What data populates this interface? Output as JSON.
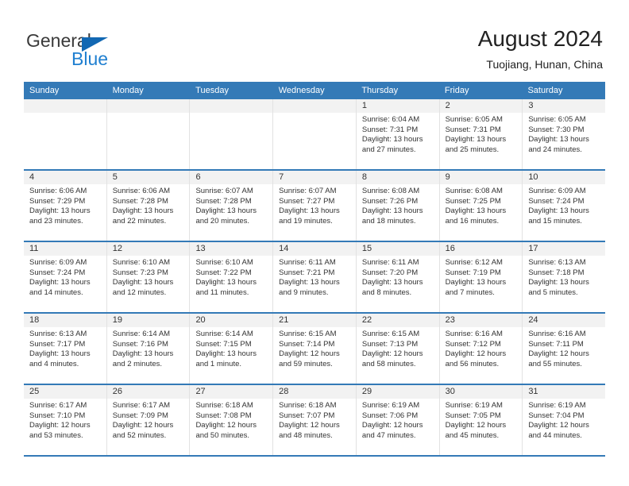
{
  "brand": {
    "name_top": "General",
    "name_bottom": "Blue",
    "triangle_color": "#1268b3",
    "blue_color": "#1f7fd0"
  },
  "header": {
    "title": "August 2024",
    "subtitle": "Tuojiang, Hunan, China"
  },
  "theme": {
    "header_row_bg": "#347ab7",
    "header_row_text": "#ffffff",
    "daynum_bg": "#f2f2f2",
    "week_divider": "#347ab7",
    "cell_divider": "#e2e2e2"
  },
  "weekdays": [
    "Sunday",
    "Monday",
    "Tuesday",
    "Wednesday",
    "Thursday",
    "Friday",
    "Saturday"
  ],
  "weeks": [
    [
      {
        "day": "",
        "sunrise": "",
        "sunset": "",
        "daylight1": "",
        "daylight2": "",
        "empty": true
      },
      {
        "day": "",
        "sunrise": "",
        "sunset": "",
        "daylight1": "",
        "daylight2": "",
        "empty": true
      },
      {
        "day": "",
        "sunrise": "",
        "sunset": "",
        "daylight1": "",
        "daylight2": "",
        "empty": true
      },
      {
        "day": "",
        "sunrise": "",
        "sunset": "",
        "daylight1": "",
        "daylight2": "",
        "empty": true
      },
      {
        "day": "1",
        "sunrise": "Sunrise: 6:04 AM",
        "sunset": "Sunset: 7:31 PM",
        "daylight1": "Daylight: 13 hours",
        "daylight2": "and 27 minutes."
      },
      {
        "day": "2",
        "sunrise": "Sunrise: 6:05 AM",
        "sunset": "Sunset: 7:31 PM",
        "daylight1": "Daylight: 13 hours",
        "daylight2": "and 25 minutes."
      },
      {
        "day": "3",
        "sunrise": "Sunrise: 6:05 AM",
        "sunset": "Sunset: 7:30 PM",
        "daylight1": "Daylight: 13 hours",
        "daylight2": "and 24 minutes."
      }
    ],
    [
      {
        "day": "4",
        "sunrise": "Sunrise: 6:06 AM",
        "sunset": "Sunset: 7:29 PM",
        "daylight1": "Daylight: 13 hours",
        "daylight2": "and 23 minutes."
      },
      {
        "day": "5",
        "sunrise": "Sunrise: 6:06 AM",
        "sunset": "Sunset: 7:28 PM",
        "daylight1": "Daylight: 13 hours",
        "daylight2": "and 22 minutes."
      },
      {
        "day": "6",
        "sunrise": "Sunrise: 6:07 AM",
        "sunset": "Sunset: 7:28 PM",
        "daylight1": "Daylight: 13 hours",
        "daylight2": "and 20 minutes."
      },
      {
        "day": "7",
        "sunrise": "Sunrise: 6:07 AM",
        "sunset": "Sunset: 7:27 PM",
        "daylight1": "Daylight: 13 hours",
        "daylight2": "and 19 minutes."
      },
      {
        "day": "8",
        "sunrise": "Sunrise: 6:08 AM",
        "sunset": "Sunset: 7:26 PM",
        "daylight1": "Daylight: 13 hours",
        "daylight2": "and 18 minutes."
      },
      {
        "day": "9",
        "sunrise": "Sunrise: 6:08 AM",
        "sunset": "Sunset: 7:25 PM",
        "daylight1": "Daylight: 13 hours",
        "daylight2": "and 16 minutes."
      },
      {
        "day": "10",
        "sunrise": "Sunrise: 6:09 AM",
        "sunset": "Sunset: 7:24 PM",
        "daylight1": "Daylight: 13 hours",
        "daylight2": "and 15 minutes."
      }
    ],
    [
      {
        "day": "11",
        "sunrise": "Sunrise: 6:09 AM",
        "sunset": "Sunset: 7:24 PM",
        "daylight1": "Daylight: 13 hours",
        "daylight2": "and 14 minutes."
      },
      {
        "day": "12",
        "sunrise": "Sunrise: 6:10 AM",
        "sunset": "Sunset: 7:23 PM",
        "daylight1": "Daylight: 13 hours",
        "daylight2": "and 12 minutes."
      },
      {
        "day": "13",
        "sunrise": "Sunrise: 6:10 AM",
        "sunset": "Sunset: 7:22 PM",
        "daylight1": "Daylight: 13 hours",
        "daylight2": "and 11 minutes."
      },
      {
        "day": "14",
        "sunrise": "Sunrise: 6:11 AM",
        "sunset": "Sunset: 7:21 PM",
        "daylight1": "Daylight: 13 hours",
        "daylight2": "and 9 minutes."
      },
      {
        "day": "15",
        "sunrise": "Sunrise: 6:11 AM",
        "sunset": "Sunset: 7:20 PM",
        "daylight1": "Daylight: 13 hours",
        "daylight2": "and 8 minutes."
      },
      {
        "day": "16",
        "sunrise": "Sunrise: 6:12 AM",
        "sunset": "Sunset: 7:19 PM",
        "daylight1": "Daylight: 13 hours",
        "daylight2": "and 7 minutes."
      },
      {
        "day": "17",
        "sunrise": "Sunrise: 6:13 AM",
        "sunset": "Sunset: 7:18 PM",
        "daylight1": "Daylight: 13 hours",
        "daylight2": "and 5 minutes."
      }
    ],
    [
      {
        "day": "18",
        "sunrise": "Sunrise: 6:13 AM",
        "sunset": "Sunset: 7:17 PM",
        "daylight1": "Daylight: 13 hours",
        "daylight2": "and 4 minutes."
      },
      {
        "day": "19",
        "sunrise": "Sunrise: 6:14 AM",
        "sunset": "Sunset: 7:16 PM",
        "daylight1": "Daylight: 13 hours",
        "daylight2": "and 2 minutes."
      },
      {
        "day": "20",
        "sunrise": "Sunrise: 6:14 AM",
        "sunset": "Sunset: 7:15 PM",
        "daylight1": "Daylight: 13 hours",
        "daylight2": "and 1 minute."
      },
      {
        "day": "21",
        "sunrise": "Sunrise: 6:15 AM",
        "sunset": "Sunset: 7:14 PM",
        "daylight1": "Daylight: 12 hours",
        "daylight2": "and 59 minutes."
      },
      {
        "day": "22",
        "sunrise": "Sunrise: 6:15 AM",
        "sunset": "Sunset: 7:13 PM",
        "daylight1": "Daylight: 12 hours",
        "daylight2": "and 58 minutes."
      },
      {
        "day": "23",
        "sunrise": "Sunrise: 6:16 AM",
        "sunset": "Sunset: 7:12 PM",
        "daylight1": "Daylight: 12 hours",
        "daylight2": "and 56 minutes."
      },
      {
        "day": "24",
        "sunrise": "Sunrise: 6:16 AM",
        "sunset": "Sunset: 7:11 PM",
        "daylight1": "Daylight: 12 hours",
        "daylight2": "and 55 minutes."
      }
    ],
    [
      {
        "day": "25",
        "sunrise": "Sunrise: 6:17 AM",
        "sunset": "Sunset: 7:10 PM",
        "daylight1": "Daylight: 12 hours",
        "daylight2": "and 53 minutes."
      },
      {
        "day": "26",
        "sunrise": "Sunrise: 6:17 AM",
        "sunset": "Sunset: 7:09 PM",
        "daylight1": "Daylight: 12 hours",
        "daylight2": "and 52 minutes."
      },
      {
        "day": "27",
        "sunrise": "Sunrise: 6:18 AM",
        "sunset": "Sunset: 7:08 PM",
        "daylight1": "Daylight: 12 hours",
        "daylight2": "and 50 minutes."
      },
      {
        "day": "28",
        "sunrise": "Sunrise: 6:18 AM",
        "sunset": "Sunset: 7:07 PM",
        "daylight1": "Daylight: 12 hours",
        "daylight2": "and 48 minutes."
      },
      {
        "day": "29",
        "sunrise": "Sunrise: 6:19 AM",
        "sunset": "Sunset: 7:06 PM",
        "daylight1": "Daylight: 12 hours",
        "daylight2": "and 47 minutes."
      },
      {
        "day": "30",
        "sunrise": "Sunrise: 6:19 AM",
        "sunset": "Sunset: 7:05 PM",
        "daylight1": "Daylight: 12 hours",
        "daylight2": "and 45 minutes."
      },
      {
        "day": "31",
        "sunrise": "Sunrise: 6:19 AM",
        "sunset": "Sunset: 7:04 PM",
        "daylight1": "Daylight: 12 hours",
        "daylight2": "and 44 minutes."
      }
    ]
  ]
}
